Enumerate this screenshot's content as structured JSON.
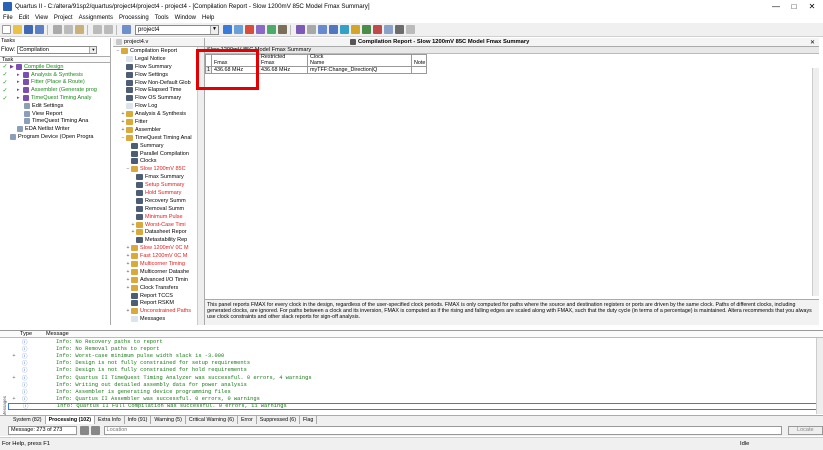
{
  "window": {
    "title": "Quartus II - C:/altera/91sp2/quartus/project4/project4 - project4 - [Compilation Report - Slow 1200mV 85C Model Fmax Summary]",
    "controls": [
      "—",
      "□",
      "✕"
    ]
  },
  "menu": [
    "File",
    "Edit",
    "View",
    "Project",
    "Assignments",
    "Processing",
    "Tools",
    "Window",
    "Help"
  ],
  "toolbar": {
    "project_select": "project4"
  },
  "tasks_pane": {
    "header": "Tasks",
    "flow_label": "Flow:",
    "flow_value": "Compilation",
    "task_col": "Task",
    "items": [
      {
        "check": "✓",
        "label": "Compile Design",
        "indent": 0,
        "style": "u"
      },
      {
        "check": "✓",
        "label": "Analysis & Synthesis",
        "indent": 1,
        "style": "g"
      },
      {
        "check": "✓",
        "label": "Fitter (Place & Route)",
        "indent": 1,
        "style": "g"
      },
      {
        "check": "✓",
        "label": "Assembler (Generate prog",
        "indent": 1,
        "style": "g"
      },
      {
        "check": "✓",
        "label": "TimeQuest Timing Analy",
        "indent": 1,
        "style": "g"
      },
      {
        "check": "",
        "label": "Edit Settings",
        "indent": 2,
        "style": ""
      },
      {
        "check": "",
        "label": "View Report",
        "indent": 2,
        "style": ""
      },
      {
        "check": "",
        "label": "TimeQuest Timing Ana",
        "indent": 2,
        "style": ""
      },
      {
        "check": "",
        "label": "EDA Netlist Writer",
        "indent": 1,
        "style": ""
      },
      {
        "check": "",
        "label": "Program Device (Open Progra",
        "indent": 0,
        "style": ""
      }
    ]
  },
  "nav_pane": {
    "tab": "project4.v",
    "items": [
      {
        "label": "Compilation Report",
        "level": 0,
        "exp": "−",
        "icon": "fold",
        "color": ""
      },
      {
        "label": "Legal Notice",
        "level": 1,
        "exp": "",
        "icon": "doc",
        "color": ""
      },
      {
        "label": "Flow Summary",
        "level": 1,
        "exp": "",
        "icon": "tbl",
        "color": ""
      },
      {
        "label": "Flow Settings",
        "level": 1,
        "exp": "",
        "icon": "tbl",
        "color": ""
      },
      {
        "label": "Flow Non-Default Glob",
        "level": 1,
        "exp": "",
        "icon": "tbl",
        "color": ""
      },
      {
        "label": "Flow Elapsed Time",
        "level": 1,
        "exp": "",
        "icon": "tbl",
        "color": ""
      },
      {
        "label": "Flow OS Summary",
        "level": 1,
        "exp": "",
        "icon": "tbl",
        "color": ""
      },
      {
        "label": "Flow Log",
        "level": 1,
        "exp": "",
        "icon": "doc",
        "color": ""
      },
      {
        "label": "Analysis & Synthesis",
        "level": 1,
        "exp": "+",
        "icon": "fold",
        "color": ""
      },
      {
        "label": "Fitter",
        "level": 1,
        "exp": "+",
        "icon": "fold",
        "color": ""
      },
      {
        "label": "Assembler",
        "level": 1,
        "exp": "+",
        "icon": "fold",
        "color": ""
      },
      {
        "label": "TimeQuest Timing Anal",
        "level": 1,
        "exp": "−",
        "icon": "fold",
        "color": ""
      },
      {
        "label": "Summary",
        "level": 2,
        "exp": "",
        "icon": "tbl",
        "color": ""
      },
      {
        "label": "Parallel Compilation",
        "level": 2,
        "exp": "",
        "icon": "tbl",
        "color": ""
      },
      {
        "label": "Clocks",
        "level": 2,
        "exp": "",
        "icon": "tbl",
        "color": ""
      },
      {
        "label": "Slow 1200mV 85C",
        "level": 2,
        "exp": "−",
        "icon": "fold",
        "color": "red"
      },
      {
        "label": "Fmax Summary",
        "level": 3,
        "exp": "",
        "icon": "tbl",
        "color": ""
      },
      {
        "label": "Setup Summary",
        "level": 3,
        "exp": "",
        "icon": "tbl",
        "color": "red"
      },
      {
        "label": "Hold Summary",
        "level": 3,
        "exp": "",
        "icon": "tbl",
        "color": "red"
      },
      {
        "label": "Recovery Summ",
        "level": 3,
        "exp": "",
        "icon": "tbl",
        "color": ""
      },
      {
        "label": "Removal Summ",
        "level": 3,
        "exp": "",
        "icon": "tbl",
        "color": ""
      },
      {
        "label": "Minimum Pulse",
        "level": 3,
        "exp": "",
        "icon": "tbl",
        "color": "red"
      },
      {
        "label": "Worst-Case Timi",
        "level": 3,
        "exp": "+",
        "icon": "fold",
        "color": "red"
      },
      {
        "label": "Datasheet Repor",
        "level": 3,
        "exp": "+",
        "icon": "fold",
        "color": ""
      },
      {
        "label": "Metastability Rep",
        "level": 3,
        "exp": "",
        "icon": "tbl",
        "color": ""
      },
      {
        "label": "Slow 1200mV 0C M",
        "level": 2,
        "exp": "+",
        "icon": "fold",
        "color": "red"
      },
      {
        "label": "Fast 1200mV 0C M",
        "level": 2,
        "exp": "+",
        "icon": "fold",
        "color": "red"
      },
      {
        "label": "Multicorner Timing",
        "level": 2,
        "exp": "+",
        "icon": "fold",
        "color": "red"
      },
      {
        "label": "Multicorner Datashe",
        "level": 2,
        "exp": "+",
        "icon": "fold",
        "color": ""
      },
      {
        "label": "Advanced I/O Timin",
        "level": 2,
        "exp": "+",
        "icon": "fold",
        "color": ""
      },
      {
        "label": "Clock Transfers",
        "level": 2,
        "exp": "+",
        "icon": "fold",
        "color": ""
      },
      {
        "label": "Report TCCS",
        "level": 2,
        "exp": "",
        "icon": "tbl",
        "color": ""
      },
      {
        "label": "Report RSKM",
        "level": 2,
        "exp": "",
        "icon": "tbl",
        "color": ""
      },
      {
        "label": "Unconstrained Paths",
        "level": 2,
        "exp": "+",
        "icon": "fold",
        "color": "red"
      },
      {
        "label": "Messages",
        "level": 2,
        "exp": "",
        "icon": "doc",
        "color": ""
      }
    ]
  },
  "main": {
    "tab": "Compilation Report - Slow 1200mV 85C Model Fmax Summary",
    "report_title": "Slow 1200mV 85C Model Fmax Summary",
    "columns": [
      "Fmax",
      "Restricted\nFmax",
      "Clock\nName",
      "Note"
    ],
    "rows": [
      {
        "num": "1",
        "cells": [
          "436.68 MHz",
          "436.68 MHz",
          "myTFF:Change_Direction|Q",
          ""
        ]
      }
    ],
    "description": "This panel reports FMAX for every clock in the design, regardless of the user-specified clock periods.  FMAX is only computed for paths where the source and destination registers or ports are driven by the same clock.  Paths of different clocks, including generated clocks, are ignored.  For paths between a clock and its inversion, FMAX is computed as if the rising and falling edges are scaled along with FMAX, such that the duty cycle (in terms of a percentage) is maintained. Altera recommends that you always use clock constraints and other slack reports for sign-off analysis."
  },
  "messages": {
    "col_type": "Type",
    "col_message": "Message",
    "rows": [
      {
        "exp": "",
        "text": "Info: No Recovery paths to report"
      },
      {
        "exp": "",
        "text": "Info: No Removal paths to report"
      },
      {
        "exp": "+",
        "text": "Info: Worst-case minimum pulse width slack is -3.000"
      },
      {
        "exp": "",
        "text": "Info: Design is not fully constrained for setup requirements"
      },
      {
        "exp": "",
        "text": "Info: Design is not fully constrained for hold requirements"
      },
      {
        "exp": "+",
        "text": "Info: Quartus II TimeQuest Timing Analyzer was successful. 0 errors, 4 warnings"
      },
      {
        "exp": "",
        "text": "Info: Writing out detailed assembly data for power analysis"
      },
      {
        "exp": "",
        "text": "Info: Assembler is generating device programming files"
      },
      {
        "exp": "+",
        "text": "Info: Quartus II Assembler was successful. 0 errors, 0 warnings"
      },
      {
        "exp": "",
        "text": "Info: Quartus II Full Compilation was successful. 0 errors, 11 warnings"
      }
    ],
    "tabs": [
      "System (82)",
      "Processing (102)",
      "Extra Info",
      "Info (91)",
      "Warning (5)",
      "Critical Warning (6)",
      "Error",
      "Suppressed (6)",
      "Flag"
    ],
    "active_tab": 1,
    "side_label": "Messages",
    "count": "Message: 273 of 273",
    "location_placeholder": "Location",
    "locate_label": "Locate"
  },
  "status": {
    "left": "For Help, press F1",
    "right": "Idle"
  },
  "colors": {
    "highlight": "#e40000",
    "info_text": "#1a7a1a",
    "check": "#1a9e1a"
  }
}
